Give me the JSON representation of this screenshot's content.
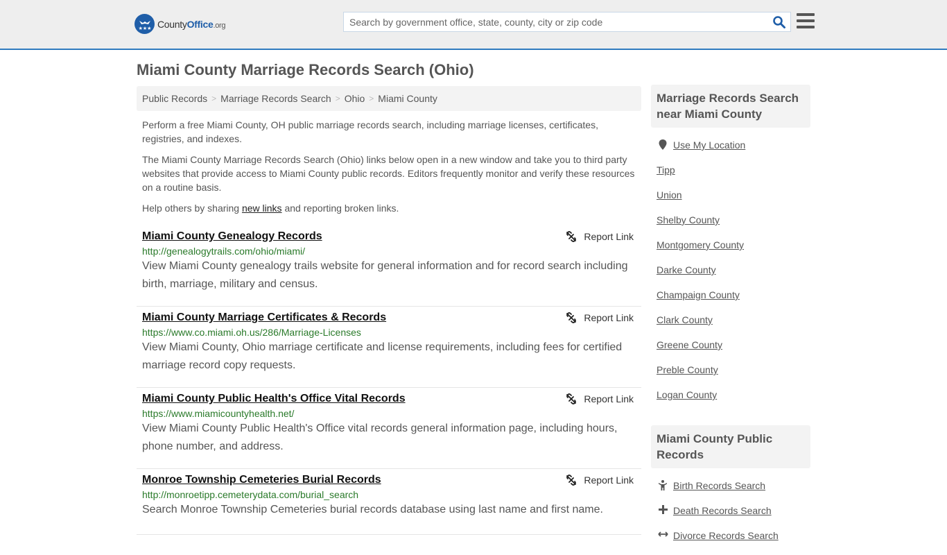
{
  "header": {
    "logo": {
      "county": "County",
      "office": "Office",
      "org": ".org"
    },
    "search_placeholder": "Search by government office, state, county, city or zip code",
    "colors": {
      "brand": "#1f5ea8",
      "accent_border": "#2f7bbf",
      "url_green": "#2a7a2a"
    }
  },
  "page_title": "Miami County Marriage Records Search (Ohio)",
  "breadcrumb": [
    {
      "label": "Public Records"
    },
    {
      "label": "Marriage Records Search"
    },
    {
      "label": "Ohio"
    },
    {
      "label": "Miami County"
    }
  ],
  "breadcrumb_separator": ">",
  "intro": {
    "p1": "Perform a free Miami County, OH public marriage records search, including marriage licenses, certificates, registries, and indexes.",
    "p2": "The Miami County Marriage Records Search (Ohio) links below open in a new window and take you to third party websites that provide access to Miami County public records. Editors frequently monitor and verify these resources on a routine basis.",
    "p3_before": "Help others by sharing ",
    "p3_link": "new links",
    "p3_after": " and reporting broken links."
  },
  "report_label": "Report Link",
  "results": [
    {
      "title": "Miami County Genealogy Records",
      "url": "http://genealogytrails.com/ohio/miami/",
      "description": "View Miami County genealogy trails website for general information and for record search including birth, marriage, military and census."
    },
    {
      "title": "Miami County Marriage Certificates & Records",
      "url": "https://www.co.miami.oh.us/286/Marriage-Licenses",
      "description": "View Miami County, Ohio marriage certificate and license requirements, including fees for certified marriage record copy requests."
    },
    {
      "title": "Miami County Public Health's Office Vital Records",
      "url": "https://www.miamicountyhealth.net/",
      "description": "View Miami County Public Health's Office vital records general information page, including hours, phone number, and address."
    },
    {
      "title": "Monroe Township Cemeteries Burial Records",
      "url": "http://monroetipp.cemeterydata.com/burial_search",
      "description": "Search Monroe Township Cemeteries burial records database using last name and first name."
    }
  ],
  "sidebar": {
    "nearby_heading": "Marriage Records Search near Miami County",
    "use_location": "Use My Location",
    "nearby": [
      "Tipp",
      "Union",
      "Shelby County",
      "Montgomery County",
      "Darke County",
      "Champaign County",
      "Clark County",
      "Greene County",
      "Preble County",
      "Logan County"
    ],
    "public_heading": "Miami County Public Records",
    "public_records": [
      {
        "label": "Birth Records Search",
        "icon": "child-icon"
      },
      {
        "label": "Death Records Search",
        "icon": "cross-icon"
      },
      {
        "label": "Divorce Records Search",
        "icon": "arrows-icon"
      }
    ]
  }
}
